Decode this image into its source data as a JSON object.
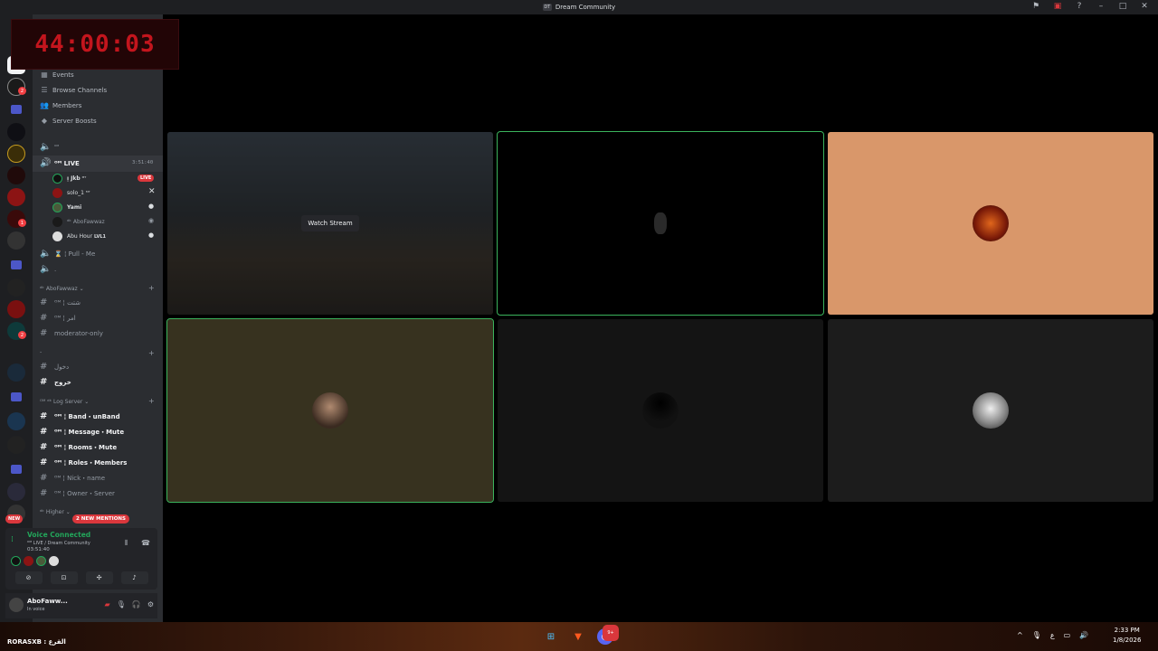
{
  "window": {
    "title": "Dream Community",
    "title_icon": "DT"
  },
  "timer": {
    "value": "44:00:03"
  },
  "sidebar": {
    "nav": [
      {
        "label": "Events",
        "icon": "calendar-icon"
      },
      {
        "label": "Browse Channels",
        "icon": "browse-icon"
      },
      {
        "label": "Members",
        "icon": "members-icon"
      },
      {
        "label": "Server Boosts",
        "icon": "boost-icon"
      }
    ],
    "voice_channel_top": "ᴼᴹ",
    "active_voice": {
      "name": "ᴼᴹ LIVE",
      "time": "3:51:40"
    },
    "voice_users": [
      {
        "name": "ᴉ Jkb",
        "tag": "ᴹᵀ",
        "live": "LIVE"
      },
      {
        "name": "solo_1",
        "tag": "ᴹᵀ"
      },
      {
        "name": "Yami"
      },
      {
        "name": "ᵈᵏ AboFawwaz"
      },
      {
        "name": "Abu Hour",
        "tag": "LVL1"
      }
    ],
    "voice_channels": [
      "⌛ ¦ Pull - Me",
      "."
    ],
    "categories": [
      {
        "name": "ᵈᵏ AboFawwaz",
        "channels": [
          {
            "label": "ᴼᴹ ¦ شتت",
            "bold": false
          },
          {
            "label": "ᴼᴹ ¦ امر",
            "bold": false
          },
          {
            "label": "moderator-only",
            "bold": false
          }
        ]
      },
      {
        "name": "-",
        "channels": [
          {
            "label": "دخول",
            "bold": false
          },
          {
            "label": "خروج",
            "bold": true
          }
        ]
      },
      {
        "name": "ᴼᴹ ᵈᵏ Log Server",
        "channels": [
          {
            "label": "ᴼᴹ ¦ Band・unBand",
            "bold": true
          },
          {
            "label": "ᴼᴹ ¦ Message・Mute",
            "bold": true
          },
          {
            "label": "ᴼᴹ ¦ Rooms・Mute",
            "bold": true
          },
          {
            "label": "ᴼᴹ ¦ Roles・Members",
            "bold": true
          },
          {
            "label": "ᴼᴹ ¦ Nick・name",
            "bold": false
          },
          {
            "label": "ᴼᴹ ¦ Owner・Server",
            "bold": false
          }
        ]
      }
    ],
    "bottom_category": "ᵈᵏ Higher",
    "new_label": "NEW",
    "mentions": "2 NEW MENTIONS"
  },
  "voice_panel": {
    "title": "Voice Connected",
    "subtitle": "ᴼᴹ LIVE / Dream Community",
    "time": "03:51:40"
  },
  "user": {
    "name": "AboFaww...",
    "status": "In voice"
  },
  "stage": {
    "watch_stream": "Watch Stream",
    "tiles": [
      {
        "kind": "stream",
        "speaking": false,
        "bg": "#2f3438"
      },
      {
        "kind": "avatar",
        "speaking": true,
        "bg": "#000000"
      },
      {
        "kind": "avatar",
        "speaking": false,
        "bg": "#d9976a"
      },
      {
        "kind": "avatar",
        "speaking": true,
        "bg": "#37321f"
      },
      {
        "kind": "avatar",
        "speaking": false,
        "bg": "#141414"
      },
      {
        "kind": "avatar",
        "speaking": false,
        "bg": "#1c1c1c"
      }
    ]
  },
  "taskbar": {
    "left_text": "RORASXB : القرع",
    "lang": "ع",
    "time": "2:33 PM",
    "date": "1/8/2026",
    "discord_badge": "9+"
  },
  "colors": {
    "green": "#23a55a",
    "red": "#da373c",
    "blurple": "#5865f2"
  }
}
